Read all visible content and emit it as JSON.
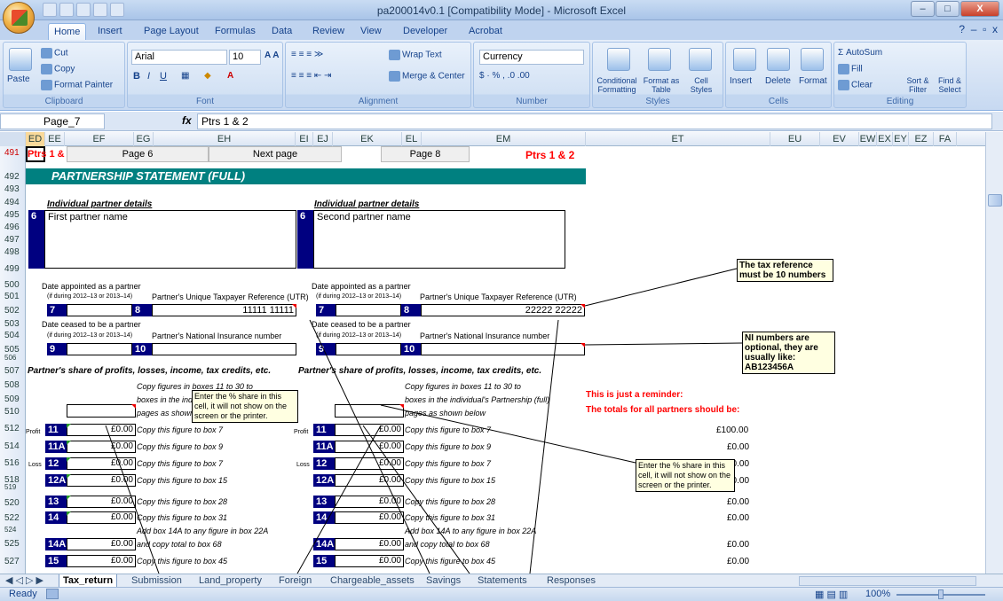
{
  "window": {
    "title": "pa200014v0.1  [Compatibility Mode] - Microsoft Excel",
    "min": "–",
    "max": "□",
    "close": "X"
  },
  "ribbon_tabs": [
    "Home",
    "Insert",
    "Page Layout",
    "Formulas",
    "Data",
    "Review",
    "View",
    "Developer",
    "Acrobat"
  ],
  "ribbon": {
    "clipboard": {
      "paste": "Paste",
      "cut": "Cut",
      "copy": "Copy",
      "format_painter": "Format Painter",
      "label": "Clipboard"
    },
    "font": {
      "name": "Arial",
      "size": "10",
      "label": "Font"
    },
    "alignment": {
      "wrap": "Wrap Text",
      "merge": "Merge & Center",
      "label": "Alignment"
    },
    "number": {
      "format": "Currency",
      "label": "Number"
    },
    "styles": {
      "cond": "Conditional Formatting",
      "table": "Format as Table",
      "cell": "Cell Styles",
      "label": "Styles"
    },
    "cells": {
      "insert": "Insert",
      "delete": "Delete",
      "format": "Format",
      "label": "Cells"
    },
    "editing": {
      "autosum": "AutoSum",
      "fill": "Fill",
      "clear": "Clear",
      "sort": "Sort & Filter",
      "find": "Find & Select",
      "label": "Editing"
    }
  },
  "formula_bar": {
    "name_box": "Page_7",
    "fx": "fx",
    "value": "Ptrs 1 & 2"
  },
  "columns": [
    "ED",
    "EE",
    "EF",
    "EG",
    "EH",
    "EI",
    "EJ",
    "EK",
    "EL",
    "EM",
    "ET",
    "EU",
    "EV",
    "EW",
    "EX",
    "EY",
    "EZ",
    "FA"
  ],
  "rows": [
    "491",
    "492",
    "493",
    "494",
    "495",
    "496",
    "497",
    "498",
    "499",
    "500",
    "501",
    "502",
    "503",
    "504",
    "505",
    "506",
    "507",
    "508",
    "509",
    "510",
    "512",
    "514",
    "516",
    "518",
    "519",
    "520",
    "522",
    "524",
    "525",
    "527"
  ],
  "sheet": {
    "ptrs_left": "Ptrs 1 & 2",
    "nav_prev": "Page 6",
    "nav_next": "Next page",
    "nav_p8": "Page 8",
    "ptrs_right": "Ptrs 1 & 2",
    "banner": "PARTNERSHIP STATEMENT (FULL)",
    "ind_details": "Individual partner details",
    "first_partner": "First partner name",
    "second_partner": "Second partner name",
    "box6": "6",
    "date_appointed": "Date appointed as a partner",
    "if_during": "(if during 2012–13 or 2013–14)",
    "utr_label": "Partner's Unique Taxpayer Reference (UTR)",
    "box7": "7",
    "box8": "8",
    "utr1": "11111 11111",
    "utr2": "22222 22222",
    "date_ceased": "Date ceased to be a partner",
    "nino_label": "Partner's National Insurance number",
    "box9": "9",
    "box10": "10",
    "share_heading": "Partner's share of profits, losses, income, tax credits, etc.",
    "copy_figs_1": "Copy figures in boxes 11 to 30 to",
    "copy_figs_2": "boxes in the individual's Partnership (full)",
    "copy_figs_3": "pages as shown below",
    "profit": "Profit",
    "loss": "Loss",
    "zero": "£0.00",
    "rows_boxes": [
      {
        "box": "11",
        "txt": "Copy this figure to box 7"
      },
      {
        "box": "11A",
        "txt": "Copy this figure to box 9"
      },
      {
        "box": "12",
        "txt": "Copy this figure to box 7"
      },
      {
        "box": "12A",
        "txt": "Copy this figure to box 15"
      },
      {
        "box": "13",
        "txt": "Copy this figure to box 28"
      },
      {
        "box": "14",
        "txt": "Copy this figure to box 31"
      },
      {
        "box": "14A",
        "txt": "and copy total to box 68"
      },
      {
        "box": "15",
        "txt": "Copy this figure to box 45"
      }
    ],
    "add_14a": "Add box 14A to any figure in box 22A",
    "reminder_1": "This is just a reminder:",
    "reminder_2": "The totals for all partners should be:",
    "totals": [
      "£100.00",
      "£0.00",
      "£0.00",
      "£0.00",
      "£0.00",
      "£0.00",
      "£0.00",
      "£0.00"
    ],
    "note_pct": "Enter the % share in this cell, it will not show on the screen or the printer.",
    "note_utr": "The tax reference must be 10 numbers",
    "note_ni": "NI numbers are optional, they are usually like: AB123456A"
  },
  "sheet_tabs": [
    "Tax_return",
    "Submission",
    "Land_property",
    "Foreign",
    "Chargeable_assets",
    "Savings",
    "Statements",
    "Responses"
  ],
  "status": {
    "ready": "Ready",
    "zoom": "100%"
  },
  "colors": {
    "navy": "#000080",
    "teal": "#008080",
    "red": "#ff0000"
  }
}
